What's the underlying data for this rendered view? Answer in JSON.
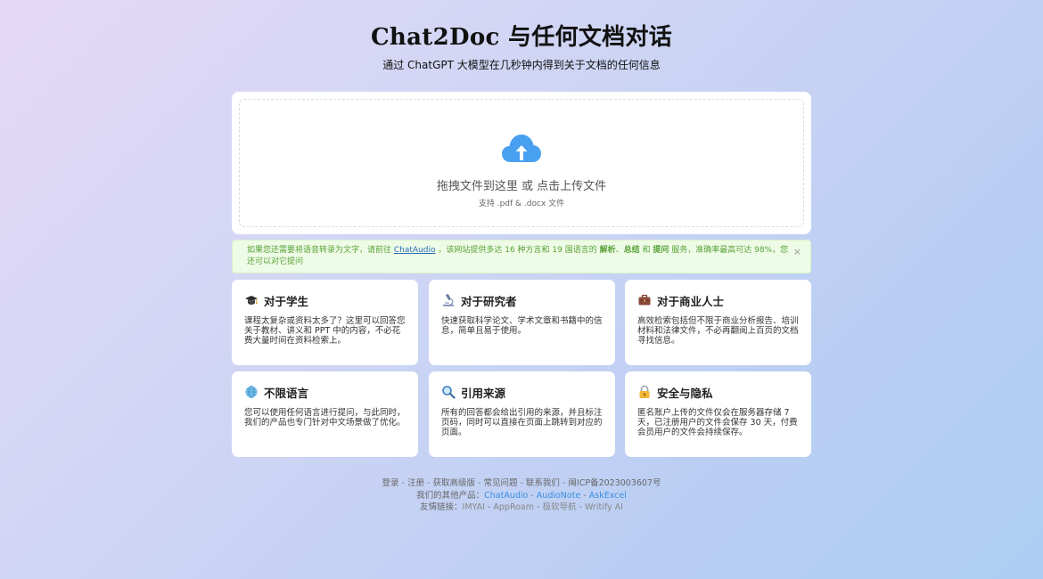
{
  "header": {
    "title": "Chat2Doc 与任何文档对话",
    "subtitle": "通过 ChatGPT 大模型在几秒钟内得到关于文档的任何信息"
  },
  "upload": {
    "text": "拖拽文件到这里 或 点击上传文件",
    "hint": "支持 .pdf & .docx 文件",
    "icon": "cloud-upload-icon",
    "accent": "#4aa0f0"
  },
  "notice": {
    "part1": "如果您还需要将语音转录为文字，请前往 ",
    "link": "ChatAudio",
    "part2": " ，该网站提供多达 16 种方言和 19 国语言的 ",
    "b1": "解析",
    "sep1": "、",
    "b2": "总结",
    "and": " 和 ",
    "b3": "提问",
    "part3": " 服务，准确率最高可达 98%，您还可以对它提问",
    "close": "×"
  },
  "cards": [
    {
      "title": "对于学生",
      "icon": "graduation-cap-icon",
      "desc": "课程太复杂或资料太多了？这里可以回答您关于教材、讲义和 PPT 中的内容，不必花费大量时间在资料检索上。"
    },
    {
      "title": "对于研究者",
      "icon": "microscope-icon",
      "desc": "快速获取科学论文、学术文章和书籍中的信息，简单且易于使用。"
    },
    {
      "title": "对于商业人士",
      "icon": "briefcase-icon",
      "desc": "高效检索包括但不限于商业分析报告、培训材料和法律文件，不必再翻阅上百页的文档寻找信息。"
    },
    {
      "title": "不限语言",
      "icon": "globe-icon",
      "desc": "您可以使用任何语言进行提问，与此同时，我们的产品也专门针对中文场景做了优化。"
    },
    {
      "title": "引用来源",
      "icon": "magnifier-icon",
      "desc": "所有的回答都会给出引用的来源，并且标注页码，同时可以直接在页面上跳转到对应的页面。"
    },
    {
      "title": "安全与隐私",
      "icon": "lock-icon",
      "desc": "匿名账户上传的文件仅会在服务器存储 7 天，已注册用户的文件会保存 30 天，付费会员用户的文件会持续保存。"
    }
  ],
  "footer": {
    "links": [
      "登录",
      "注册",
      "获取高级版",
      "常见问题",
      "联系我们",
      "闽ICP备2023003607号"
    ],
    "products_label": "我们的其他产品：",
    "products": [
      "ChatAudio",
      "AudioNote",
      "AskExcel"
    ],
    "friends_label": "友情链接：",
    "friends": [
      "IMYAI",
      "AppRoam",
      "极软导航",
      "Writify AI"
    ],
    "separator": " - "
  }
}
